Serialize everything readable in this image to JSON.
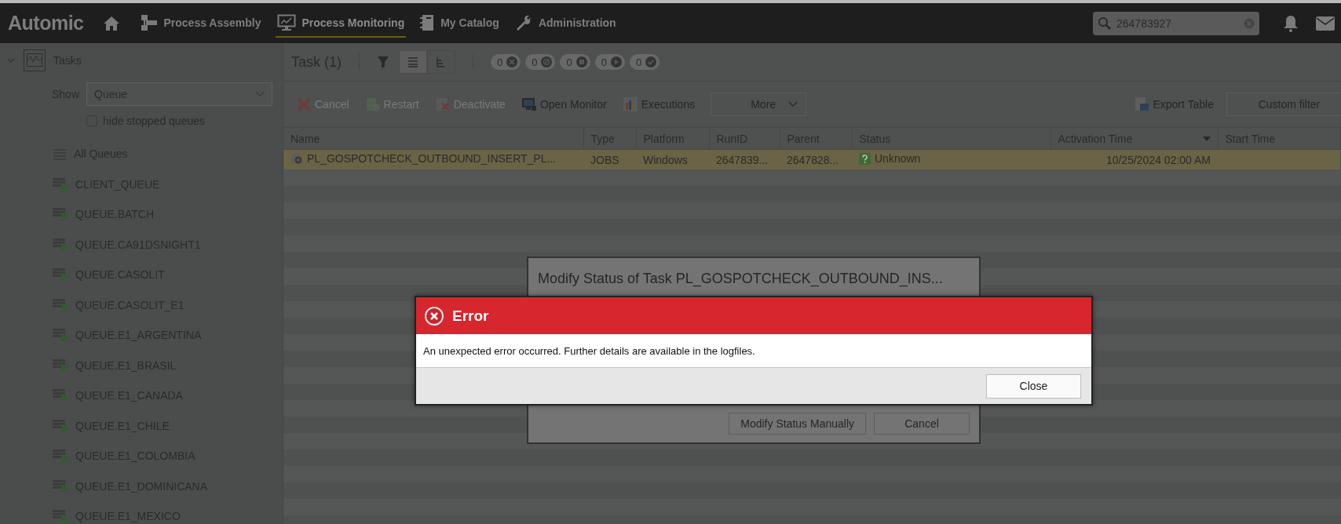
{
  "topbar": {
    "logo": "Automic",
    "nav": [
      {
        "label": "Process Assembly",
        "kind": "assembly",
        "selected": false
      },
      {
        "label": "Process Monitoring",
        "kind": "monitoring",
        "selected": true
      },
      {
        "label": "My Catalog",
        "kind": "catalog",
        "selected": false
      },
      {
        "label": "Administration",
        "kind": "admin",
        "selected": false
      }
    ],
    "search": {
      "value": "264783927"
    }
  },
  "sidebar": {
    "root": {
      "label": "Tasks",
      "expanded": true
    },
    "show_label": "Show",
    "show_value": "Queue",
    "hide_stopped": {
      "label": "hide stopped queues",
      "checked": false
    },
    "queues": [
      {
        "label": "All Queues",
        "kind": "all"
      },
      {
        "label": "CLIENT_QUEUE",
        "kind": "queue"
      },
      {
        "label": "QUEUE.BATCH",
        "kind": "queue"
      },
      {
        "label": "QUEUE.CA91DSNIGHT1",
        "kind": "queue"
      },
      {
        "label": "QUEUE.CASOLIT",
        "kind": "queue"
      },
      {
        "label": "QUEUE.CASOLIT_E1",
        "kind": "queue"
      },
      {
        "label": "QUEUE.E1_ARGENTINA",
        "kind": "queue"
      },
      {
        "label": "QUEUE.E1_BRASIL",
        "kind": "queue"
      },
      {
        "label": "QUEUE.E1_CANADA",
        "kind": "queue"
      },
      {
        "label": "QUEUE.E1_CHILE",
        "kind": "queue"
      },
      {
        "label": "QUEUE.E1_COLOMBIA",
        "kind": "queue"
      },
      {
        "label": "QUEUE.E1_DOMINICANA",
        "kind": "queue"
      },
      {
        "label": "QUEUE.E1_MEXICO",
        "kind": "queue"
      }
    ]
  },
  "main": {
    "title": "Task (1)",
    "views": [
      {
        "kind": "list",
        "selected": true
      },
      {
        "kind": "tree",
        "selected": false
      }
    ],
    "counters": [
      {
        "count": "0",
        "kind": "cancelled"
      },
      {
        "count": "0",
        "kind": "blocked"
      },
      {
        "count": "0",
        "kind": "waiting"
      },
      {
        "count": "0",
        "kind": "running"
      },
      {
        "count": "0",
        "kind": "ended"
      }
    ],
    "toolbar": [
      {
        "label": "Cancel",
        "kind": "cancel",
        "disabled": true
      },
      {
        "label": "Restart",
        "kind": "restart",
        "disabled": true
      },
      {
        "label": "Deactivate",
        "kind": "deactivate",
        "disabled": true
      },
      {
        "label": "Open Monitor",
        "kind": "monitor",
        "disabled": false
      },
      {
        "label": "Executions",
        "kind": "executions",
        "disabled": false
      }
    ],
    "more": "More",
    "export": "Export Table",
    "custom_filter": "Custom filter",
    "table": {
      "columns": [
        {
          "label": "Name",
          "sorted": false
        },
        {
          "label": "Type",
          "sorted": false
        },
        {
          "label": "Platform",
          "sorted": false
        },
        {
          "label": "RunID",
          "sorted": false
        },
        {
          "label": "Parent",
          "sorted": false
        },
        {
          "label": "Status",
          "sorted": false
        },
        {
          "label": "Activation Time",
          "sorted": true
        },
        {
          "label": "Start Time",
          "sorted": false
        }
      ],
      "rows": [
        {
          "selected": true,
          "cells": [
            "PL_GOSPOTCHECK_OUTBOUND_INSERT_PL...",
            "JOBS",
            "Windows",
            "2647839...",
            "2647828...",
            "Unknown",
            "10/25/2024 02:00 AM",
            ""
          ]
        }
      ]
    }
  },
  "modify_dialog": {
    "title": "Modify Status of Task PL_GOSPOTCHECK_OUTBOUND_INS...",
    "buttons": [
      "Modify Status Manually",
      "Cancel"
    ]
  },
  "error_dialog": {
    "title": "Error",
    "message": "An unexpected error occurred. Further details are available in the logfiles.",
    "button": "Close"
  }
}
